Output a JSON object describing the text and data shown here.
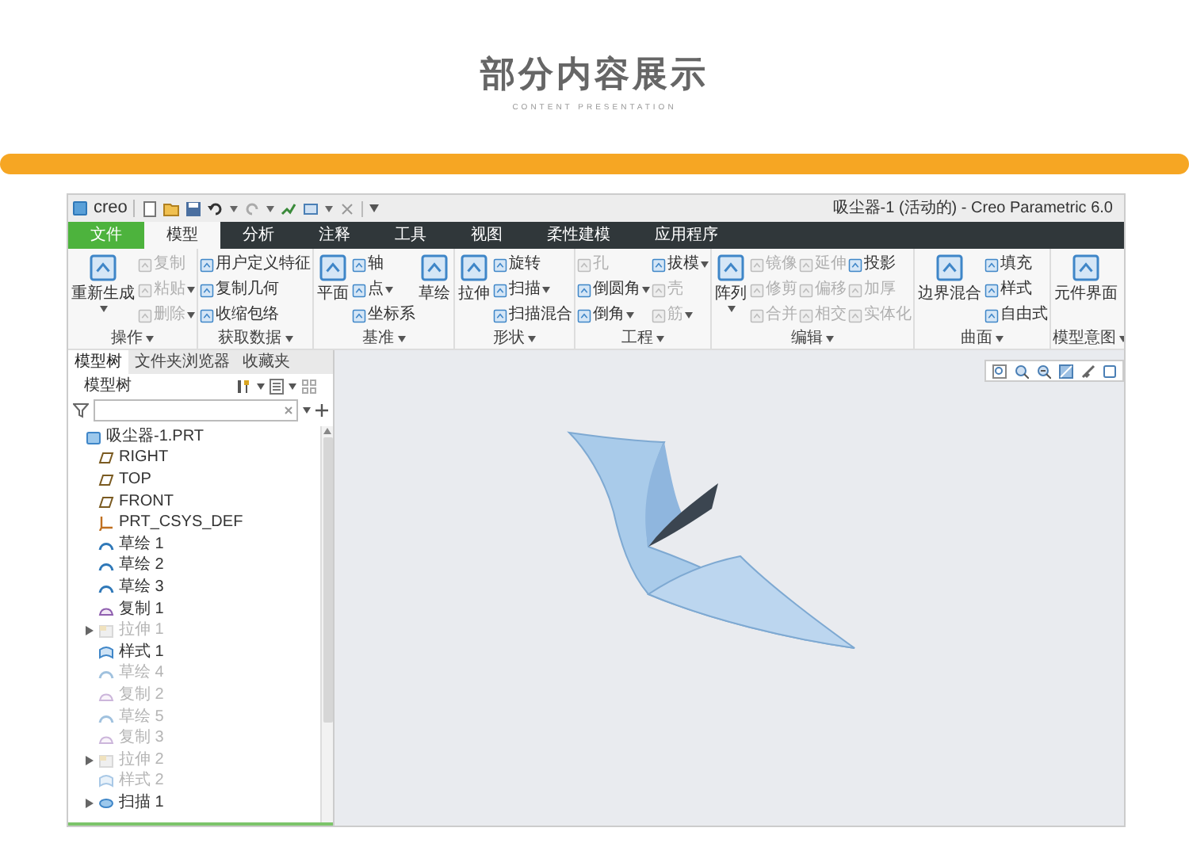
{
  "header": {
    "title": "部分内容展示",
    "subtitle": "CONTENT PRESENTATION"
  },
  "app": {
    "logo": "creo",
    "title": "吸尘器-1 (活动的) - Creo Parametric 6.0",
    "tabs": [
      {
        "label": "文件",
        "kind": "file",
        "selected": false
      },
      {
        "label": "模型",
        "kind": "tab",
        "selected": true
      },
      {
        "label": "分析",
        "kind": "tab",
        "selected": false
      },
      {
        "label": "注释",
        "kind": "tab",
        "selected": false
      },
      {
        "label": "工具",
        "kind": "tab",
        "selected": false
      },
      {
        "label": "视图",
        "kind": "tab",
        "selected": false
      },
      {
        "label": "柔性建模",
        "kind": "tab",
        "selected": false
      },
      {
        "label": "应用程序",
        "kind": "tab",
        "selected": false
      }
    ],
    "ribbon": [
      {
        "label": "操作",
        "columns": [
          {
            "kind": "large",
            "label": "重新生成",
            "menu": true,
            "disabled": false
          },
          {
            "kind": "stack",
            "items": [
              {
                "label": "复制",
                "menu": false,
                "disabled": true
              },
              {
                "label": "粘贴",
                "menu": true,
                "disabled": true
              },
              {
                "label": "删除",
                "menu": true,
                "disabled": true
              }
            ]
          }
        ]
      },
      {
        "label": "获取数据",
        "columns": [
          {
            "kind": "stack",
            "items": [
              {
                "label": "用户定义特征",
                "menu": false,
                "disabled": false
              },
              {
                "label": "复制几何",
                "menu": false,
                "disabled": false
              },
              {
                "label": "收缩包络",
                "menu": false,
                "disabled": false
              }
            ]
          }
        ]
      },
      {
        "label": "基准",
        "columns": [
          {
            "kind": "large",
            "label": "平面",
            "menu": false,
            "disabled": false
          },
          {
            "kind": "stack",
            "items": [
              {
                "label": "轴",
                "menu": false,
                "disabled": false
              },
              {
                "label": "点",
                "menu": true,
                "disabled": false
              },
              {
                "label": "坐标系",
                "menu": false,
                "disabled": false
              }
            ]
          },
          {
            "kind": "large",
            "label": "草绘",
            "menu": false,
            "disabled": false
          }
        ]
      },
      {
        "label": "形状",
        "columns": [
          {
            "kind": "large",
            "label": "拉伸",
            "menu": false,
            "disabled": false
          },
          {
            "kind": "stack",
            "items": [
              {
                "label": "旋转",
                "menu": false,
                "disabled": false
              },
              {
                "label": "扫描",
                "menu": true,
                "disabled": false
              },
              {
                "label": "扫描混合",
                "menu": false,
                "disabled": false
              }
            ]
          }
        ]
      },
      {
        "label": "工程",
        "columns": [
          {
            "kind": "stack",
            "items": [
              {
                "label": "孔",
                "menu": false,
                "disabled": true
              },
              {
                "label": "倒圆角",
                "menu": true,
                "disabled": false
              },
              {
                "label": "倒角",
                "menu": true,
                "disabled": false
              }
            ]
          },
          {
            "kind": "stack",
            "items": [
              {
                "label": "拔模",
                "menu": true,
                "disabled": false
              },
              {
                "label": "壳",
                "menu": false,
                "disabled": true
              },
              {
                "label": "筋",
                "menu": true,
                "disabled": true
              }
            ]
          }
        ]
      },
      {
        "label": "编辑",
        "columns": [
          {
            "kind": "large",
            "label": "阵列",
            "menu": true,
            "disabled": false
          },
          {
            "kind": "stack",
            "items": [
              {
                "label": "镜像",
                "menu": false,
                "disabled": true
              },
              {
                "label": "修剪",
                "menu": false,
                "disabled": true
              },
              {
                "label": "合并",
                "menu": false,
                "disabled": true
              }
            ]
          },
          {
            "kind": "stack",
            "items": [
              {
                "label": "延伸",
                "menu": false,
                "disabled": true
              },
              {
                "label": "偏移",
                "menu": false,
                "disabled": true
              },
              {
                "label": "相交",
                "menu": false,
                "disabled": true
              }
            ]
          },
          {
            "kind": "stack",
            "items": [
              {
                "label": "投影",
                "menu": false,
                "disabled": false
              },
              {
                "label": "加厚",
                "menu": false,
                "disabled": true
              },
              {
                "label": "实体化",
                "menu": false,
                "disabled": true
              }
            ]
          }
        ]
      },
      {
        "label": "曲面",
        "columns": [
          {
            "kind": "large",
            "label": "边界混合",
            "menu": false,
            "disabled": false
          },
          {
            "kind": "stack",
            "items": [
              {
                "label": "填充",
                "menu": false,
                "disabled": false
              },
              {
                "label": "样式",
                "menu": false,
                "disabled": false
              },
              {
                "label": "自由式",
                "menu": false,
                "disabled": false
              }
            ]
          }
        ]
      },
      {
        "label": "模型意图",
        "columns": [
          {
            "kind": "large",
            "label": "元件界面",
            "menu": false,
            "disabled": false
          }
        ]
      }
    ],
    "panel_tabs": [
      {
        "label": "模型树",
        "selected": true
      },
      {
        "label": "文件夹浏览器",
        "selected": false
      },
      {
        "label": "收藏夹",
        "selected": false
      }
    ],
    "tree_title": "模型树",
    "tree": [
      {
        "label": "吸尘器-1.PRT",
        "kind": "part",
        "dimmed": false,
        "expander": false,
        "children": [
          {
            "label": "RIGHT",
            "kind": "plane",
            "dimmed": false,
            "expander": false
          },
          {
            "label": "TOP",
            "kind": "plane",
            "dimmed": false,
            "expander": false
          },
          {
            "label": "FRONT",
            "kind": "plane",
            "dimmed": false,
            "expander": false
          },
          {
            "label": "PRT_CSYS_DEF",
            "kind": "csys",
            "dimmed": false,
            "expander": false
          },
          {
            "label": "草绘 1",
            "kind": "sketch",
            "dimmed": false,
            "expander": false
          },
          {
            "label": "草绘 2",
            "kind": "sketch",
            "dimmed": false,
            "expander": false
          },
          {
            "label": "草绘 3",
            "kind": "sketch",
            "dimmed": false,
            "expander": false
          },
          {
            "label": "复制 1",
            "kind": "copy",
            "dimmed": false,
            "expander": false
          },
          {
            "label": "拉伸 1",
            "kind": "extrude",
            "dimmed": true,
            "expander": true
          },
          {
            "label": "样式 1",
            "kind": "style",
            "dimmed": false,
            "expander": false
          },
          {
            "label": "草绘 4",
            "kind": "sketch",
            "dimmed": true,
            "expander": false
          },
          {
            "label": "复制 2",
            "kind": "copy",
            "dimmed": true,
            "expander": false
          },
          {
            "label": "草绘 5",
            "kind": "sketch",
            "dimmed": true,
            "expander": false
          },
          {
            "label": "复制 3",
            "kind": "copy",
            "dimmed": true,
            "expander": false
          },
          {
            "label": "拉伸 2",
            "kind": "extrude",
            "dimmed": true,
            "expander": true
          },
          {
            "label": "样式 2",
            "kind": "style",
            "dimmed": true,
            "expander": false
          },
          {
            "label": "扫描 1",
            "kind": "sweep",
            "dimmed": false,
            "expander": true
          }
        ]
      }
    ]
  }
}
